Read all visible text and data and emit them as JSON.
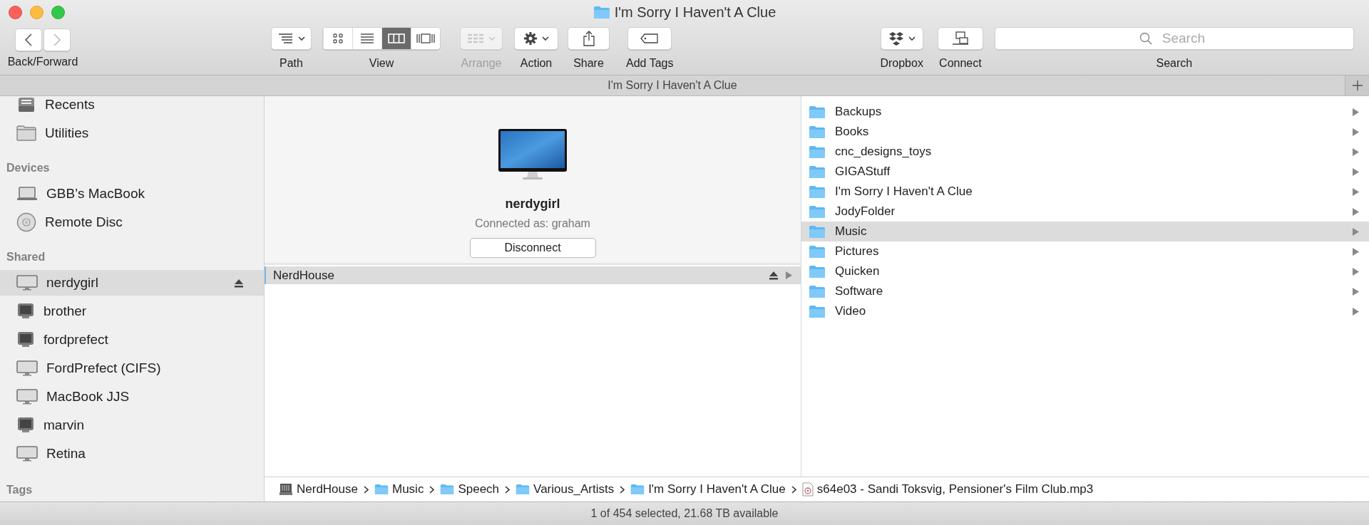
{
  "window": {
    "title": "I'm Sorry I Haven't A Clue"
  },
  "toolbar": {
    "navigation": {
      "label": "Back/Forward",
      "back_disabled": false,
      "forward_disabled": true
    },
    "items": [
      {
        "kind": "path",
        "label": "Path",
        "disabled": false
      },
      {
        "kind": "view",
        "label": "View",
        "disabled": false,
        "modes": [
          {
            "kind": "icons",
            "selected": false
          },
          {
            "kind": "list",
            "selected": false
          },
          {
            "kind": "columns",
            "selected": true
          },
          {
            "kind": "gallery",
            "selected": false
          }
        ]
      },
      {
        "kind": "arrange",
        "label": "Arrange",
        "disabled": true
      },
      {
        "kind": "action",
        "label": "Action",
        "disabled": false
      },
      {
        "kind": "share",
        "label": "Share",
        "disabled": false
      },
      {
        "kind": "tags",
        "label": "Add Tags",
        "disabled": false
      },
      {
        "kind": "dropbox",
        "label": "Dropbox",
        "disabled": false
      },
      {
        "kind": "connect",
        "label": "Connect",
        "disabled": false
      }
    ],
    "search": {
      "placeholder": "Search",
      "label": "Search"
    }
  },
  "tab_bar": {
    "title": "I'm Sorry I Haven't A Clue"
  },
  "sidebar": {
    "sections": [
      {
        "items": [
          {
            "kind": "recents",
            "label": "Recents",
            "selected": false,
            "ejectable": false
          },
          {
            "kind": "folder",
            "label": "Utilities",
            "selected": false,
            "ejectable": false
          }
        ]
      },
      {
        "heading": "Devices",
        "items": [
          {
            "kind": "laptop",
            "label": "GBB’s MacBook",
            "selected": false,
            "ejectable": false
          },
          {
            "kind": "disc",
            "label": "Remote Disc",
            "selected": false,
            "ejectable": false
          }
        ]
      },
      {
        "heading": "Shared",
        "items": [
          {
            "kind": "display",
            "label": "nerdygirl",
            "selected": true,
            "ejectable": true
          },
          {
            "kind": "old-display",
            "label": "brother",
            "selected": false,
            "ejectable": false
          },
          {
            "kind": "old-display",
            "label": "fordprefect",
            "selected": false,
            "ejectable": false
          },
          {
            "kind": "display",
            "label": "FordPrefect (CIFS)",
            "selected": false,
            "ejectable": false
          },
          {
            "kind": "display",
            "label": "MacBook JJS",
            "selected": false,
            "ejectable": false
          },
          {
            "kind": "old-display",
            "label": "marvin",
            "selected": false,
            "ejectable": false
          },
          {
            "kind": "display",
            "label": "Retina",
            "selected": false,
            "ejectable": false
          }
        ]
      },
      {
        "heading": "Tags"
      }
    ]
  },
  "server_panel": {
    "name": "nerdygirl",
    "status": "Connected as: graham",
    "button": "Disconnect"
  },
  "share_column": [
    {
      "label": "NerdHouse",
      "selected": true,
      "ejectable": true
    }
  ],
  "folder_column": [
    {
      "label": "Backups",
      "selected": false
    },
    {
      "label": "Books",
      "selected": false
    },
    {
      "label": "cnc_designs_toys",
      "selected": false
    },
    {
      "label": "GIGAStuff",
      "selected": false
    },
    {
      "label": "I'm Sorry I Haven't A Clue",
      "selected": false
    },
    {
      "label": "JodyFolder",
      "selected": false
    },
    {
      "label": "Music",
      "selected": true
    },
    {
      "label": "Pictures",
      "selected": false
    },
    {
      "label": "Quicken",
      "selected": false
    },
    {
      "label": "Software",
      "selected": false
    },
    {
      "label": "Video",
      "selected": false
    }
  ],
  "path_bar": [
    {
      "kind": "volume",
      "label": "NerdHouse"
    },
    {
      "kind": "folder",
      "label": "Music"
    },
    {
      "kind": "folder",
      "label": "Speech"
    },
    {
      "kind": "folder",
      "label": "Various_Artists"
    },
    {
      "kind": "folder",
      "label": "I'm Sorry I Haven't A Clue"
    },
    {
      "kind": "audio",
      "label": "s64e03 - Sandi Toksvig, Pensioner's Film Club.mp3"
    }
  ],
  "status_bar": "1 of 454 selected, 21.68 TB available"
}
